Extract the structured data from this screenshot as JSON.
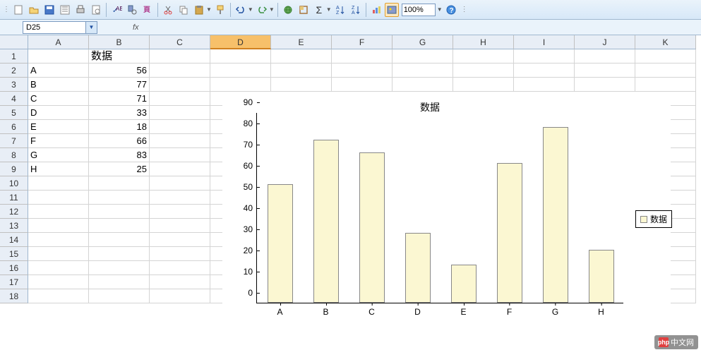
{
  "toolbar": {
    "zoom": "100%",
    "icons": [
      "new",
      "open",
      "save",
      "save-as",
      "print",
      "preview",
      "spell",
      "research",
      "cut",
      "copy",
      "paste",
      "format-painter",
      "undo",
      "redo",
      "hyperlink",
      "border",
      "autosum",
      "sort-asc",
      "sort-desc",
      "chart",
      "drawing",
      "help"
    ]
  },
  "formula_bar": {
    "cell_ref": "D25",
    "fx": "fx",
    "formula": ""
  },
  "columns": [
    "A",
    "B",
    "C",
    "D",
    "E",
    "F",
    "G",
    "H",
    "I",
    "J",
    "K"
  ],
  "active_column": "D",
  "row_count": 18,
  "sheet": {
    "header_b1": "数据",
    "rows": [
      {
        "a": "A",
        "b": "56"
      },
      {
        "a": "B",
        "b": "77"
      },
      {
        "a": "C",
        "b": "71"
      },
      {
        "a": "D",
        "b": "33"
      },
      {
        "a": "E",
        "b": "18"
      },
      {
        "a": "F",
        "b": "66"
      },
      {
        "a": "G",
        "b": "83"
      },
      {
        "a": "H",
        "b": "25"
      }
    ]
  },
  "chart_data": {
    "type": "bar",
    "title": "数据",
    "categories": [
      "A",
      "B",
      "C",
      "D",
      "E",
      "F",
      "G",
      "H"
    ],
    "values": [
      56,
      77,
      71,
      33,
      18,
      66,
      83,
      25
    ],
    "ylim": [
      0,
      90
    ],
    "ystep": 10,
    "legend": "数据"
  },
  "watermark": "中文网"
}
